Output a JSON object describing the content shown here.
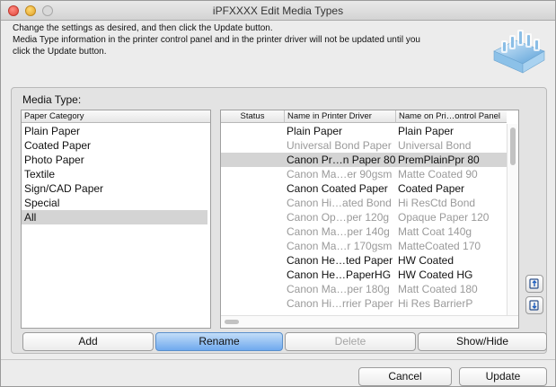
{
  "window": {
    "title": "iPFXXXX Edit Media Types"
  },
  "instructions": {
    "line1": "Change the settings as desired, and then click the Update button.",
    "line2": "Media Type information in the printer control panel and in the printer driver will not be updated until you",
    "line3": "click the Update button."
  },
  "logo_icon": "printer-media-logo-icon",
  "media_type": {
    "label": "Media Type:",
    "category_header": "Paper Category",
    "categories": [
      {
        "label": "Plain Paper"
      },
      {
        "label": "Coated Paper"
      },
      {
        "label": "Photo Paper"
      },
      {
        "label": "Textile"
      },
      {
        "label": "Sign/CAD Paper"
      },
      {
        "label": "Special"
      },
      {
        "label": "All",
        "selected": true
      }
    ],
    "columns": {
      "status": "Status",
      "driver_name": "Name in Printer Driver",
      "panel_name": "Name on Pri…ontrol Panel"
    },
    "media": [
      {
        "status": "",
        "driver": "Plain Paper",
        "panel": "Plain Paper",
        "dimmed": false
      },
      {
        "status": "",
        "driver": "Universal Bond Paper",
        "panel": "Universal Bond",
        "dimmed": true
      },
      {
        "status": "",
        "driver": "Canon Pr…n Paper 80",
        "panel": "PremPlainPpr 80",
        "dimmed": false,
        "selected": true
      },
      {
        "status": "",
        "driver": "Canon Ma…er 90gsm",
        "panel": "Matte Coated 90",
        "dimmed": true
      },
      {
        "status": "",
        "driver": "Canon Coated Paper",
        "panel": "Coated Paper",
        "dimmed": false
      },
      {
        "status": "",
        "driver": "Canon Hi…ated Bond",
        "panel": "Hi ResCtd Bond",
        "dimmed": true
      },
      {
        "status": "",
        "driver": "Canon Op…per 120g",
        "panel": "Opaque Paper 120",
        "dimmed": true
      },
      {
        "status": "",
        "driver": "Canon Ma…per 140g",
        "panel": "Matt Coat 140g",
        "dimmed": true
      },
      {
        "status": "",
        "driver": "Canon Ma…r 170gsm",
        "panel": "MatteCoated 170",
        "dimmed": true
      },
      {
        "status": "",
        "driver": "Canon He…ted Paper",
        "panel": "HW Coated",
        "dimmed": false
      },
      {
        "status": "",
        "driver": "Canon He…PaperHG",
        "panel": "HW Coated HG",
        "dimmed": false
      },
      {
        "status": "",
        "driver": "Canon Ma…per 180g",
        "panel": "Matt Coated 180",
        "dimmed": true
      },
      {
        "status": "",
        "driver": "Canon Hi…rrier Paper",
        "panel": "Hi Res BarrierP",
        "dimmed": true
      }
    ]
  },
  "side_buttons": {
    "move_up_icon": "move-up-icon",
    "move_down_icon": "move-down-icon"
  },
  "buttons": {
    "add": "Add",
    "rename": "Rename",
    "delete": "Delete",
    "show_hide": "Show/Hide",
    "cancel": "Cancel",
    "update": "Update"
  },
  "colors": {
    "accent": "#6fa9ee",
    "selection": "#d4d4d4",
    "disabled_text": "#9a9a9a"
  }
}
